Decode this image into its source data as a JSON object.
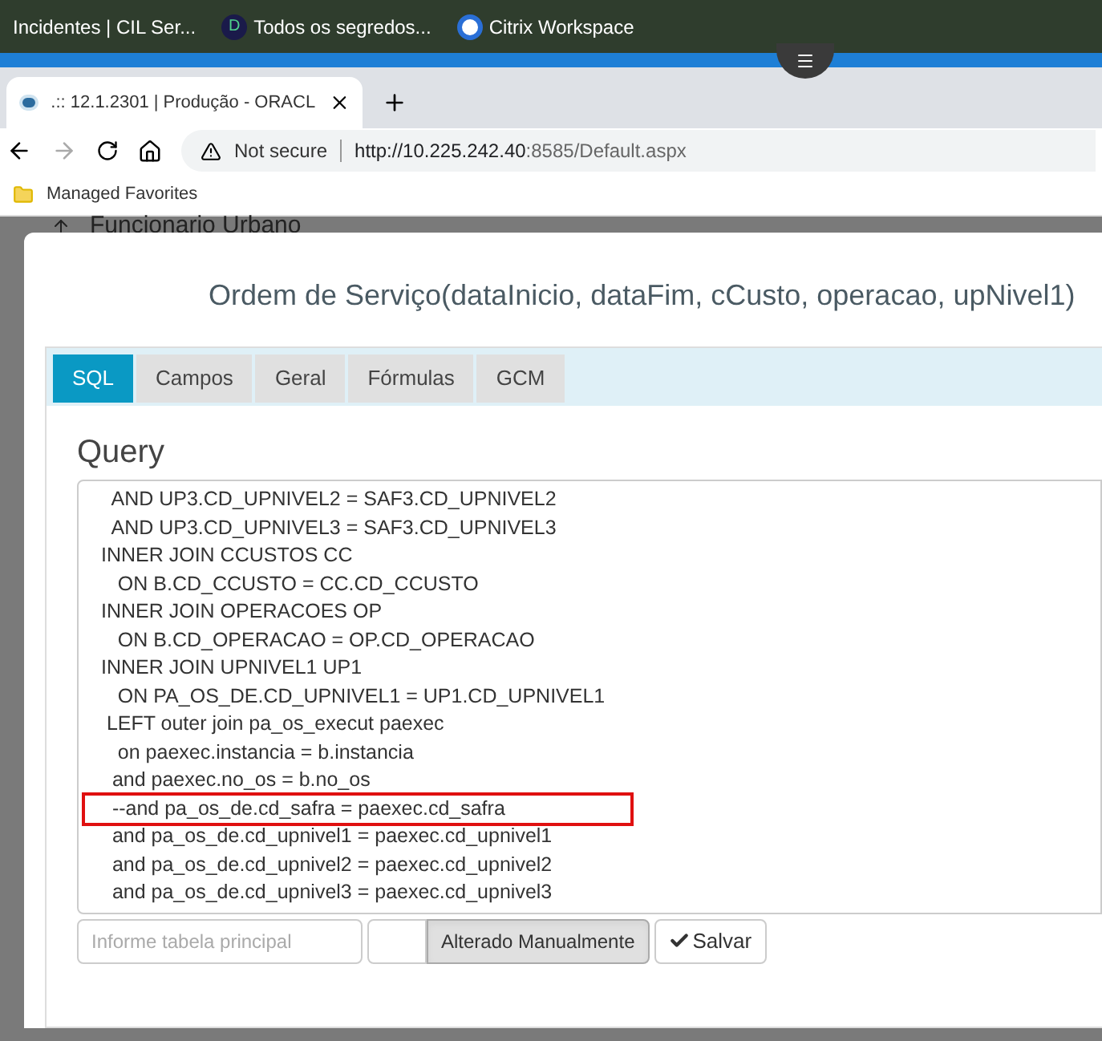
{
  "taskbar": {
    "shortcuts": [
      {
        "label": "Incidentes | CIL Ser...",
        "kind": "none"
      },
      {
        "label": "Todos os segredos...",
        "kind": "letter",
        "icon_letter": "D"
      },
      {
        "label": "Citrix Workspace",
        "kind": "citrix"
      }
    ]
  },
  "browser": {
    "tab_title": ".:: 12.1.2301 | Produção - ORACL",
    "security": "Not secure",
    "url_host": "http://10.225.242.40",
    "url_rest": ":8585/Default.aspx",
    "bookmarks": [
      "Managed Favorites"
    ]
  },
  "page": {
    "heading": "Funcionario Urbano"
  },
  "dialog": {
    "title": "Ordem de Serviço(dataInicio, dataFim, cCusto, operacao, upNivel1)",
    "tabs": [
      {
        "label": "SQL",
        "selected": true
      },
      {
        "label": "Campos",
        "selected": false
      },
      {
        "label": "Geral",
        "selected": false
      },
      {
        "label": "Fórmulas",
        "selected": false
      },
      {
        "label": "GCM",
        "selected": false
      }
    ],
    "query_label": "Query",
    "query_lines": [
      {
        "text": "  AND UP3.CD_UPNIVEL2 = SAF3.CD_UPNIVEL2",
        "highlighted": false
      },
      {
        "text": "  AND UP3.CD_UPNIVEL3 = SAF3.CD_UPNIVEL3",
        "highlighted": false
      },
      {
        "text": "INNER JOIN CCUSTOS CC",
        "highlighted": false
      },
      {
        "text": "   ON B.CD_CCUSTO = CC.CD_CCUSTO",
        "highlighted": false
      },
      {
        "text": "INNER JOIN OPERACOES OP",
        "highlighted": false
      },
      {
        "text": "   ON B.CD_OPERACAO = OP.CD_OPERACAO",
        "highlighted": false
      },
      {
        "text": "INNER JOIN UPNIVEL1 UP1",
        "highlighted": false
      },
      {
        "text": "   ON PA_OS_DE.CD_UPNIVEL1 = UP1.CD_UPNIVEL1",
        "highlighted": false
      },
      {
        "text": " LEFT outer join pa_os_execut paexec",
        "highlighted": false
      },
      {
        "text": "   on paexec.instancia = b.instancia",
        "highlighted": false
      },
      {
        "text": "  and paexec.no_os = b.no_os",
        "highlighted": false
      },
      {
        "text": "  --and pa_os_de.cd_safra = paexec.cd_safra",
        "highlighted": true
      },
      {
        "text": "  and pa_os_de.cd_upnivel1 = paexec.cd_upnivel1",
        "highlighted": false
      },
      {
        "text": "  and pa_os_de.cd_upnivel2 = paexec.cd_upnivel2",
        "highlighted": false
      },
      {
        "text": "  and pa_os_de.cd_upnivel3 = paexec.cd_upnivel3",
        "highlighted": false
      }
    ],
    "table_field": {
      "placeholder": "Informe tabela principal"
    },
    "manual_button": {
      "label": "Alterado Manualmente",
      "pressed": true
    },
    "save_button": {
      "label": "Salvar"
    }
  }
}
